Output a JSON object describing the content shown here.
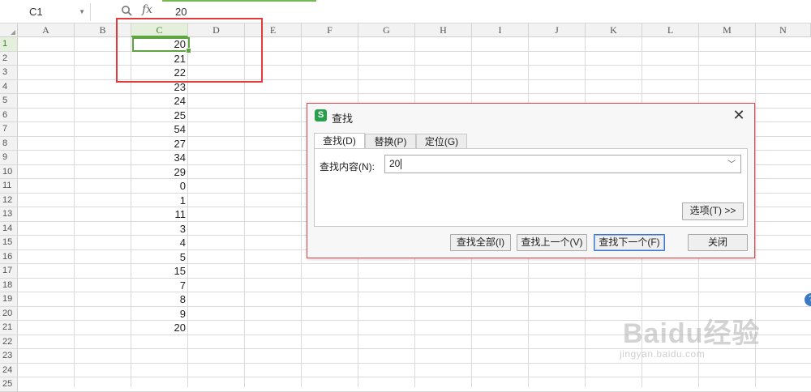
{
  "formula_bar": {
    "cell_ref": "C1",
    "fx_label": "fx",
    "value": "20"
  },
  "columns": [
    "A",
    "B",
    "C",
    "D",
    "E",
    "F",
    "G",
    "H",
    "I",
    "J",
    "K",
    "L",
    "M",
    "N"
  ],
  "selected_column": "C",
  "rows": [
    "1",
    "2",
    "3",
    "4",
    "5",
    "6",
    "7",
    "8",
    "9",
    "10",
    "11",
    "12",
    "13",
    "14",
    "15",
    "16",
    "17",
    "18",
    "19",
    "20",
    "21",
    "22",
    "23",
    "24",
    "25"
  ],
  "column_c_values": [
    "20",
    "21",
    "22",
    "23",
    "24",
    "25",
    "54",
    "27",
    "34",
    "29",
    "0",
    "1",
    "11",
    "3",
    "4",
    "5",
    "15",
    "7",
    "8",
    "9",
    "20"
  ],
  "find_dialog": {
    "title": "查找",
    "logo_letter": "S",
    "tabs": [
      "查找(D)",
      "替换(P)",
      "定位(G)"
    ],
    "active_tab": "查找(D)",
    "search_label": "查找内容(N):",
    "search_value": "20",
    "options_button": "选项(T) >>",
    "find_all_button": "查找全部(I)",
    "find_prev_button": "查找上一个(V)",
    "find_next_button": "查找下一个(F)",
    "close_button": "关闭"
  },
  "watermark": {
    "brand": "Baidu经验",
    "url": "jingyan.baidu.com"
  },
  "colors": {
    "selection_green": "#5ea541",
    "highlight_red": "#e23b3b",
    "dialog_border": "#d94a4a",
    "logo_green": "#27a04b"
  }
}
